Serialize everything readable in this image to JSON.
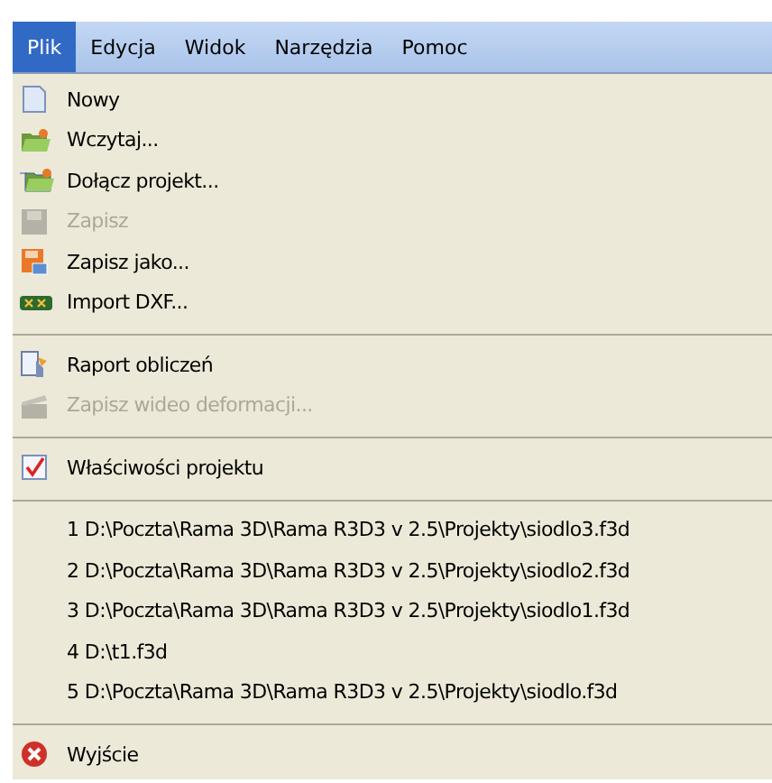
{
  "menubar": [
    {
      "label": "Plik",
      "selected": true
    },
    {
      "label": "Edycja",
      "selected": false
    },
    {
      "label": "Widok",
      "selected": false
    },
    {
      "label": "Narzędzia",
      "selected": false
    },
    {
      "label": "Pomoc",
      "selected": false
    }
  ],
  "menu": [
    {
      "kind": "command",
      "label": "Nowy",
      "disabled": false
    },
    {
      "kind": "command",
      "label": "Wczytaj...",
      "disabled": false
    },
    {
      "kind": "command",
      "label": "Dołącz projekt...",
      "disabled": false
    },
    {
      "kind": "command",
      "label": "Zapisz",
      "disabled": true
    },
    {
      "kind": "command",
      "label": "Zapisz jako...",
      "disabled": false
    },
    {
      "kind": "command",
      "label": "Import DXF...",
      "disabled": false
    },
    {
      "kind": "separator"
    },
    {
      "kind": "command",
      "label": "Raport obliczeń",
      "disabled": false
    },
    {
      "kind": "command",
      "label": "Zapisz wideo deformacji...",
      "disabled": true
    },
    {
      "kind": "separator"
    },
    {
      "kind": "command",
      "label": "Właściwości projektu",
      "disabled": false
    },
    {
      "kind": "separator"
    },
    {
      "kind": "recent",
      "label": "1 D:\\Poczta\\Rama 3D\\Rama R3D3 v 2.5\\Projekty\\siodlo3.f3d"
    },
    {
      "kind": "recent",
      "label": "2 D:\\Poczta\\Rama 3D\\Rama R3D3 v 2.5\\Projekty\\siodlo2.f3d"
    },
    {
      "kind": "recent",
      "label": "3 D:\\Poczta\\Rama 3D\\Rama R3D3 v 2.5\\Projekty\\siodlo1.f3d"
    },
    {
      "kind": "recent",
      "label": "4 D:\\t1.f3d"
    },
    {
      "kind": "recent",
      "label": "5 D:\\Poczta\\Rama 3D\\Rama R3D3 v 2.5\\Projekty\\siodlo.f3d"
    },
    {
      "kind": "separator"
    },
    {
      "kind": "command",
      "label": "Wyjście",
      "disabled": false
    }
  ]
}
